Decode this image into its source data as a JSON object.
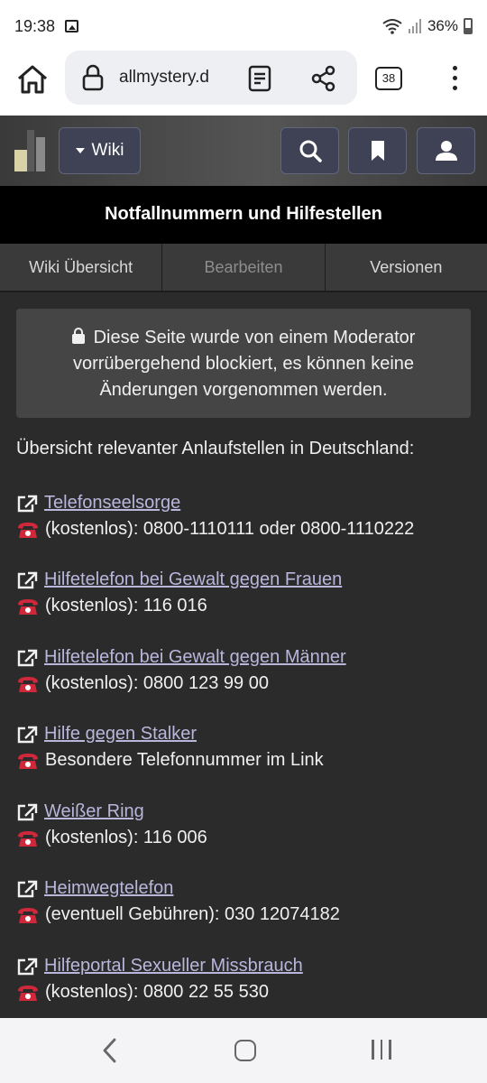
{
  "status_bar": {
    "time": "19:38",
    "battery": "36%"
  },
  "browser": {
    "url": "allmystery.d",
    "tab_count": "38"
  },
  "header": {
    "wiki_label": "Wiki"
  },
  "page": {
    "title": "Notfallnummern und Hilfestellen",
    "tabs": [
      {
        "label": "Wiki Übersicht",
        "enabled": true
      },
      {
        "label": "Bearbeiten",
        "enabled": false
      },
      {
        "label": "Versionen",
        "enabled": true
      }
    ],
    "notice": {
      "line1": "Diese Seite wurde von einem Moderator",
      "line2": "vorrübergehend blockiert, es können keine",
      "line3": "Änderungen vorgenommen werden."
    },
    "intro": "Übersicht relevanter Anlaufstellen in Deutschland:",
    "entries": [
      {
        "link": "Telefonseelsorge",
        "detail": "(kostenlos): 0800-1110111 oder 0800-1110222"
      },
      {
        "link": "Hilfetelefon bei Gewalt gegen Frauen",
        "detail": "(kostenlos): 116 016"
      },
      {
        "link": "Hilfetelefon bei Gewalt gegen Männer",
        "detail": "(kostenlos): 0800 123 99 00"
      },
      {
        "link": "Hilfe gegen Stalker",
        "detail": "Besondere Telefonnummer im Link"
      },
      {
        "link": "Weißer Ring",
        "detail": "(kostenlos): 116 006"
      },
      {
        "link": "Heimwegtelefon",
        "detail": "(eventuell Gebühren): 030 12074182"
      },
      {
        "link": "Hilfeportal Sexueller Missbrauch",
        "detail": "(kostenlos): 0800 22 55 530"
      }
    ]
  },
  "icons": {
    "status": [
      "image-icon",
      "wifi-icon",
      "signal-icon",
      "battery-icon"
    ],
    "browser": [
      "home-icon",
      "lock-icon",
      "reader-mode-icon",
      "share-icon",
      "tabs-icon",
      "more-icon"
    ],
    "header": [
      "site-logo",
      "caret-down-icon",
      "search-icon",
      "bookmark-icon",
      "user-icon"
    ],
    "entries": [
      "external-link-icon",
      "telephone-icon"
    ],
    "nav": [
      "back-icon",
      "home-icon",
      "recent-apps-icon"
    ]
  },
  "colors": {
    "background": "#2b2b2b",
    "link": "#b9b6dc",
    "title_bar": "#000000",
    "header_button": "#3f4254",
    "phone": "#d0283b"
  }
}
